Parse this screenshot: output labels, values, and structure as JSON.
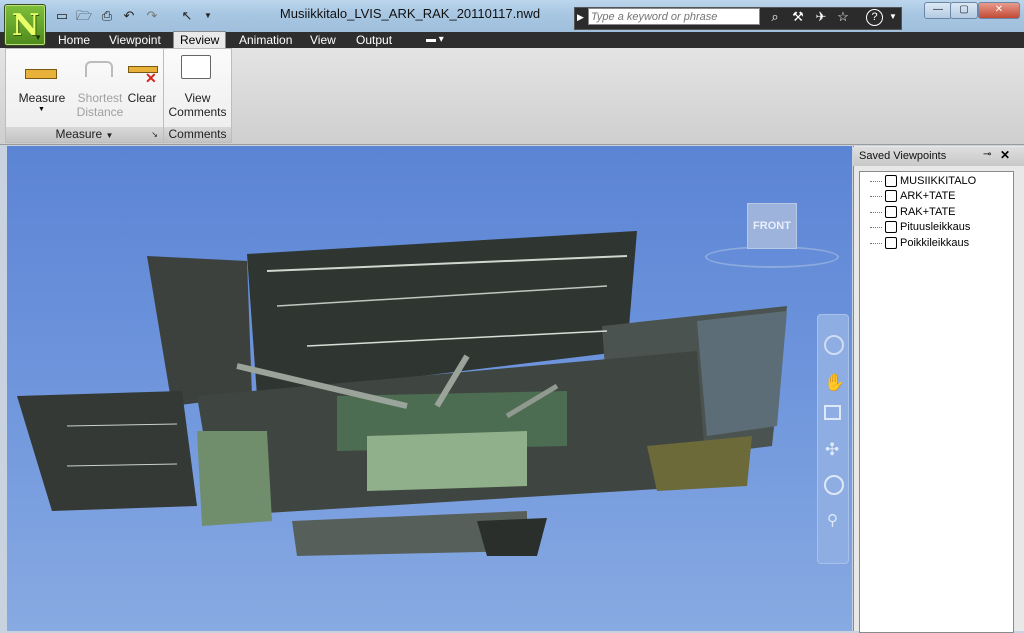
{
  "window": {
    "title": "Musiikkitalo_LVIS_ARK_RAK_20110117.nwd",
    "min": "—",
    "max": "▢",
    "close": "✕"
  },
  "app_button": {
    "letter": "N"
  },
  "search": {
    "placeholder": "Type a keyword or phrase"
  },
  "menu": {
    "home": "Home",
    "viewpoint": "Viewpoint",
    "review": "Review",
    "animation": "Animation",
    "view": "View",
    "output": "Output"
  },
  "ribbon": {
    "measure_label": "Measure",
    "shortest_line1": "Shortest",
    "shortest_line2": "Distance",
    "clear_label": "Clear",
    "view_line1": "View",
    "view_line2": "Comments",
    "measure_panel": "Measure",
    "comments_panel": "Comments"
  },
  "viewcube": {
    "face": "FRONT"
  },
  "saved_viewpoints": {
    "title": "Saved Viewpoints",
    "items": [
      "MUSIIKKITALO",
      "ARK+TATE",
      "RAK+TATE",
      "Pituusleikkaus",
      "Poikkileikkaus"
    ]
  },
  "colors": {
    "sky_top": "#5b84d4",
    "sky_bottom": "#88aae2",
    "menubar": "#2e2e2e",
    "model_dark": "#3a3f3a"
  }
}
